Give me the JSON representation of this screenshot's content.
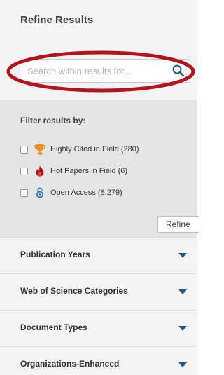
{
  "panel": {
    "title": "Refine Results"
  },
  "search": {
    "placeholder": "Search within results for...",
    "value": ""
  },
  "filters": {
    "heading": "Filter results by:",
    "items": [
      {
        "label": "Highly Cited in Field (280)",
        "icon": "trophy-icon",
        "color": "#f08c1d"
      },
      {
        "label": "Hot Papers in Field (6)",
        "icon": "flame-icon",
        "color": "#b5131a"
      },
      {
        "label": "Open Access (8,279)",
        "icon": "open-access-icon",
        "color": "#1f6fbf"
      }
    ],
    "refine_label": "Refine"
  },
  "accordions": [
    {
      "label": "Publication Years"
    },
    {
      "label": "Web of Science Categories"
    },
    {
      "label": "Document Types"
    },
    {
      "label": "Organizations-Enhanced"
    }
  ],
  "colors": {
    "annotation": "#b5121b",
    "chevron": "#1a5a8a",
    "search_icon": "#1a5a8a"
  }
}
